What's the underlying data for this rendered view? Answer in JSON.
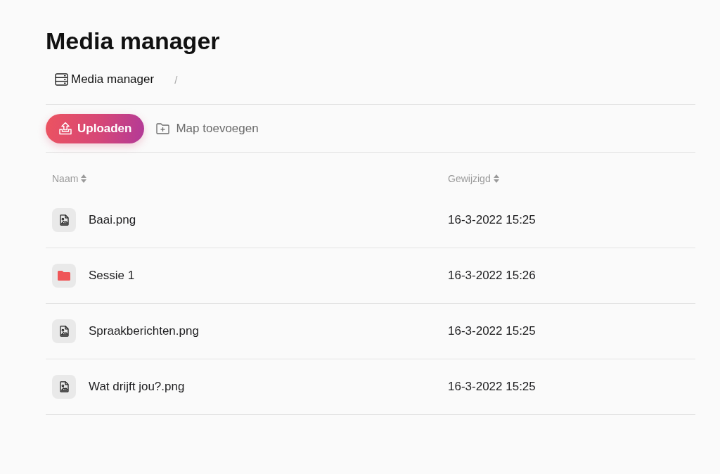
{
  "title": "Media manager",
  "breadcrumb": {
    "items": [
      {
        "label": "Media manager"
      }
    ],
    "separator": "/"
  },
  "toolbar": {
    "upload_button": "Uploaden",
    "add_folder_button": "Map toevoegen"
  },
  "table": {
    "columns": [
      "Naam",
      "Gewijzigd"
    ],
    "rows": [
      {
        "kind": "file",
        "name": "Baai.png",
        "modified": "16-3-2022 15:25"
      },
      {
        "kind": "folder",
        "name": "Sessie 1",
        "modified": "16-3-2022 15:26"
      },
      {
        "kind": "file",
        "name": "Spraakberichten.png",
        "modified": "16-3-2022 15:25"
      },
      {
        "kind": "file",
        "name": "Wat drijft jou?.png",
        "modified": "16-3-2022 15:25"
      }
    ]
  }
}
